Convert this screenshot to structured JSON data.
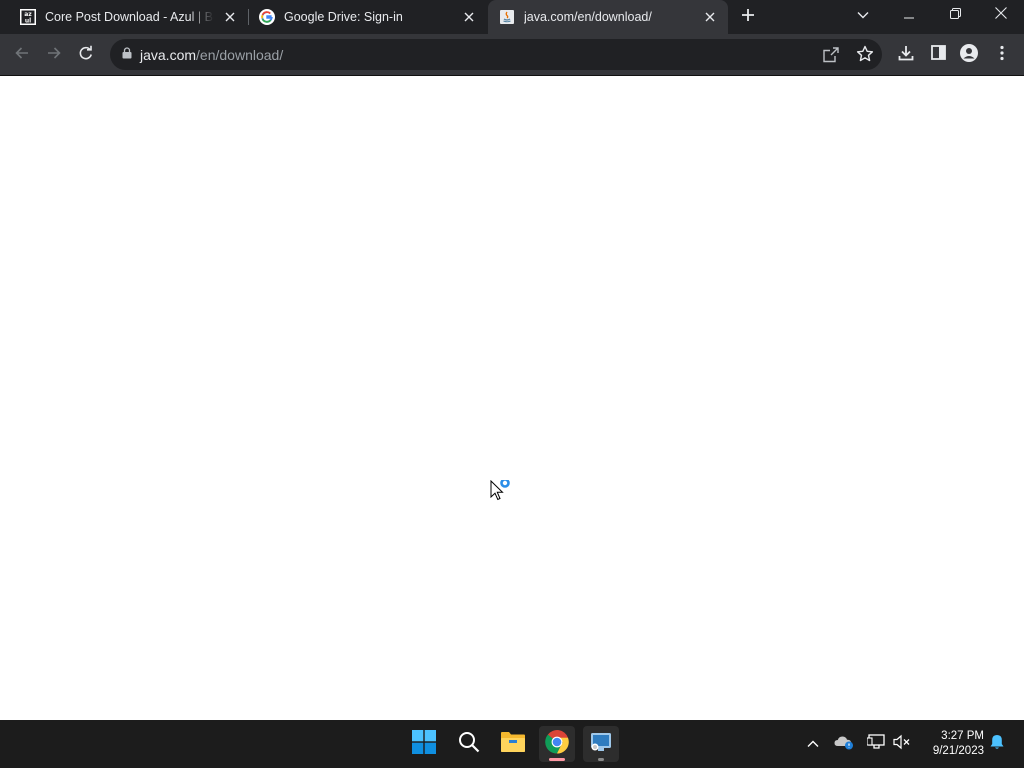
{
  "browser": {
    "tabs": [
      {
        "title": "Core Post Download - Azul | Better Java Performance",
        "favicon": "azul-icon",
        "active": false
      },
      {
        "title": "Google Drive: Sign-in",
        "favicon": "google-icon",
        "active": false
      },
      {
        "title": "java.com/en/download/",
        "favicon": "java-icon",
        "active": true
      }
    ],
    "address": {
      "host": "java.com",
      "path": "/en/download/"
    }
  },
  "taskbar": {
    "apps": [
      "windows-start-icon",
      "search-icon",
      "file-explorer-icon",
      "chrome-icon",
      "remote-desktop-icon"
    ],
    "clock": {
      "time": "3:27 PM",
      "date": "9/21/2023"
    }
  },
  "colors": {
    "tabstrip": "#202124",
    "toolbar": "#35363a",
    "taskbar": "#1c1c1c",
    "loading": "#2b8ee8"
  }
}
